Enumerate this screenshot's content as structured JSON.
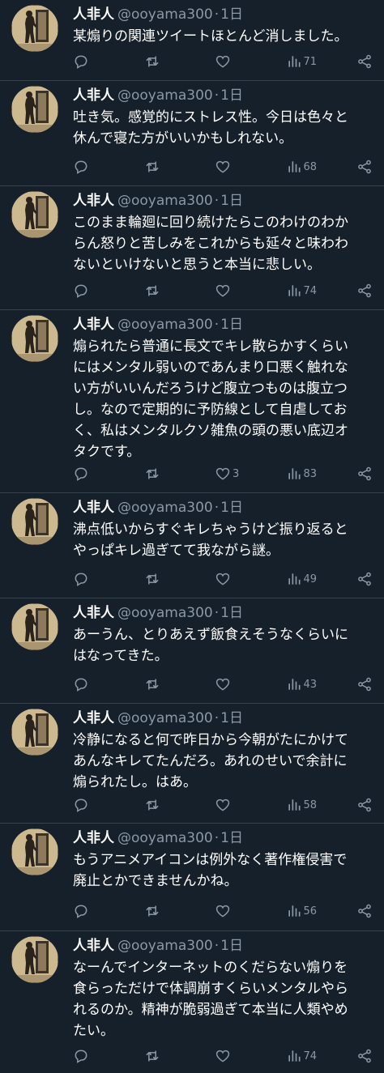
{
  "tweets": [
    {
      "name": "人非人",
      "handle": "@ooyama300",
      "time": "1日",
      "text": "某煽りの関連ツイートほとんど消しました。",
      "replies": "",
      "retweets": "",
      "likes": "",
      "views": "71"
    },
    {
      "name": "人非人",
      "handle": "@ooyama300",
      "time": "1日",
      "text": "吐き気。感覚的にストレス性。今日は色々と\n休んで寝た方がいいかもしれない。",
      "replies": "",
      "retweets": "",
      "likes": "",
      "views": "68"
    },
    {
      "name": "人非人",
      "handle": "@ooyama300",
      "time": "1日",
      "text": "このまま輪廻に回り続けたらこのわけのわか\nらん怒りと苦しみをこれからも延々と味わわ\nないといけないと思うと本当に悲しい。",
      "replies": "",
      "retweets": "",
      "likes": "",
      "views": "74"
    },
    {
      "name": "人非人",
      "handle": "@ooyama300",
      "time": "1日",
      "text": "煽られたら普通に長文でキレ散らかすくらい\nにはメンタル弱いのであんまり口悪く触れな\nい方がいいんだろうけど腹立つものは腹立つ\nし。なので定期的に予防線として自虐してお\nく、私はメンタルクソ雑魚の頭の悪い底辺オ\nタクです。",
      "replies": "",
      "retweets": "",
      "likes": "3",
      "views": "83"
    },
    {
      "name": "人非人",
      "handle": "@ooyama300",
      "time": "1日",
      "text": "沸点低いからすぐキレちゃうけど振り返ると\nやっぱキレ過ぎてて我ながら謎。",
      "replies": "",
      "retweets": "",
      "likes": "",
      "views": "49"
    },
    {
      "name": "人非人",
      "handle": "@ooyama300",
      "time": "1日",
      "text": "あーうん、とりあえず飯食えそうなくらいに\nはなってきた。",
      "replies": "",
      "retweets": "",
      "likes": "",
      "views": "43"
    },
    {
      "name": "人非人",
      "handle": "@ooyama300",
      "time": "1日",
      "text": "冷静になると何で昨日から今朝がたにかけて\nあんなキレてたんだろ。あれのせいで余計に\n煽られたし。はあ。",
      "replies": "",
      "retweets": "",
      "likes": "",
      "views": "58"
    },
    {
      "name": "人非人",
      "handle": "@ooyama300",
      "time": "1日",
      "text": "もうアニメアイコンは例外なく著作権侵害で\n廃止とかできませんかね。",
      "replies": "",
      "retweets": "",
      "likes": "",
      "views": "56"
    },
    {
      "name": "人非人",
      "handle": "@ooyama300",
      "time": "1日",
      "text": "なーんでインターネットのくだらない煽りを\n食らっただけで体調崩すくらいメンタルやら\nれるのか。精神が脆弱過ぎて本当に人類やめ\nたい。",
      "replies": "",
      "retweets": "",
      "likes": "",
      "views": "74"
    }
  ],
  "icons": {
    "reply": "reply-icon",
    "retweet": "retweet-icon",
    "like": "heart-icon",
    "views": "views-icon",
    "share": "share-icon"
  },
  "colors": {
    "background": "#15202b",
    "divider": "#38444d",
    "muted": "#8b98a5",
    "text": "#ffffff"
  }
}
